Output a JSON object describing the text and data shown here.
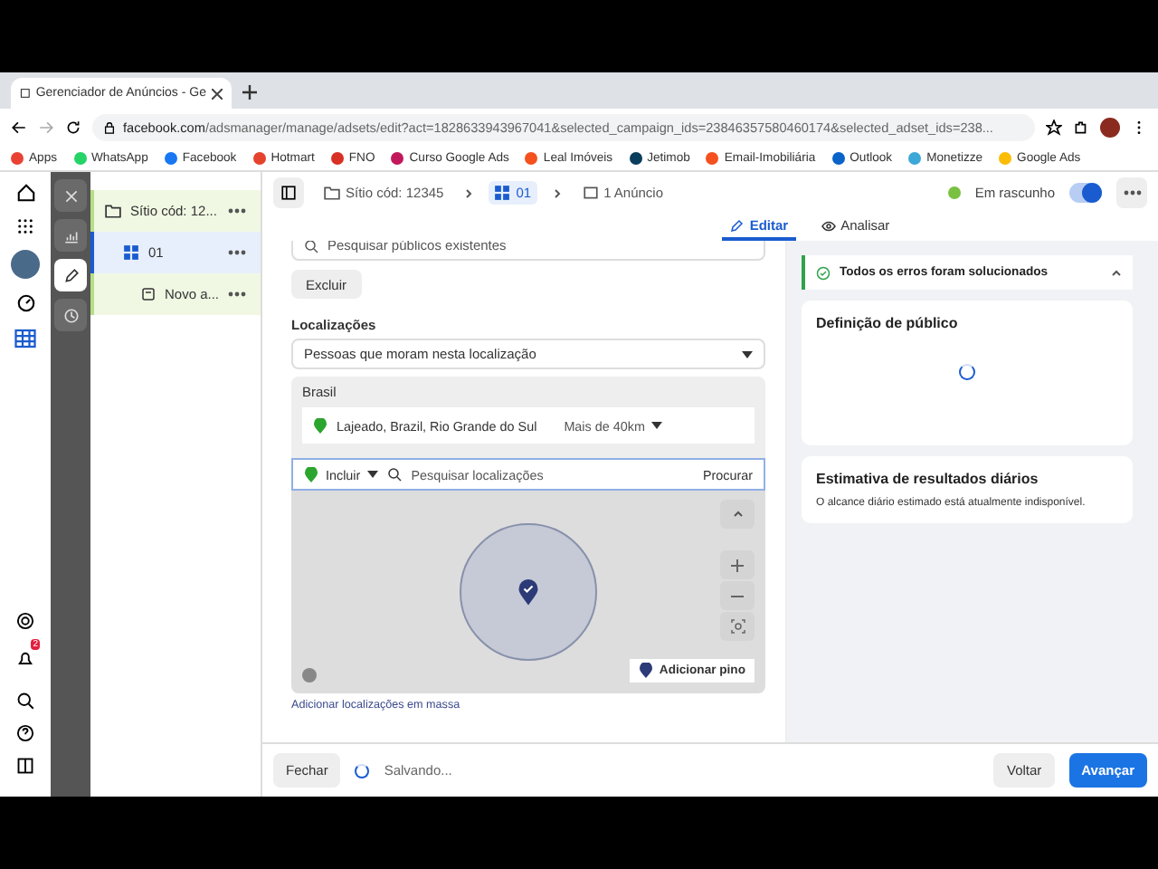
{
  "browser": {
    "tab_title": "Gerenciador de Anúncios - Ge",
    "url_host": "facebook.com",
    "url_path": "/adsmanager/manage/adsets/edit?act=1828633943967041&selected_campaign_ids=23846357580460174&selected_adset_ids=238...",
    "bookmarks": [
      {
        "label": "Apps",
        "color": "#e94235"
      },
      {
        "label": "WhatsApp",
        "color": "#25d366"
      },
      {
        "label": "Facebook",
        "color": "#1877f2"
      },
      {
        "label": "Hotmart",
        "color": "#e4432d"
      },
      {
        "label": "FNO",
        "color": "#d93025"
      },
      {
        "label": "Curso Google Ads",
        "color": "#c2185b"
      },
      {
        "label": "Leal Imóveis",
        "color": "#f4511e"
      },
      {
        "label": "Jetimob",
        "color": "#0b3d5c"
      },
      {
        "label": "Email-Imobiliária",
        "color": "#f4511e"
      },
      {
        "label": "Outlook",
        "color": "#0a64c8"
      },
      {
        "label": "Monetizze",
        "color": "#3ba8d8"
      },
      {
        "label": "Google Ads",
        "color": "#fbbc04"
      }
    ]
  },
  "nav": {
    "notification_count": "2"
  },
  "rail": [
    {
      "kind": "close",
      "selected": false
    },
    {
      "kind": "chart",
      "selected": false
    },
    {
      "kind": "edit",
      "selected": true
    },
    {
      "kind": "clock",
      "selected": false
    }
  ],
  "tree": [
    {
      "label": "Sítio cód: 12...",
      "selected": false,
      "children": [
        {
          "label": "01",
          "selected": true,
          "children": [
            {
              "label": "Novo a...",
              "selected": false
            }
          ]
        }
      ]
    }
  ],
  "header": {
    "breadcrumb": [
      {
        "kind": "campaign",
        "label": "Sítio cód: 12345",
        "selected": false
      },
      {
        "kind": "adset",
        "label": "01",
        "selected": true
      },
      {
        "kind": "ad",
        "label": "1 Anúncio",
        "selected": false
      }
    ],
    "status": "Em rascunho",
    "toggle_on": true
  },
  "tabs": [
    {
      "kind": "edit",
      "label": "Editar",
      "selected": true
    },
    {
      "kind": "view",
      "label": "Analisar",
      "selected": false
    }
  ],
  "form": {
    "audience_search_placeholder": "Pesquisar públicos existentes",
    "exclude_button": "Excluir",
    "locations_label": "Localizações",
    "locations_select": "Pessoas que moram nesta localização",
    "country": "Brasil",
    "location": "Lajeado, Brazil, Rio Grande do Sul",
    "radius": "Mais de 40km",
    "include": "Incluir",
    "location_search_placeholder": "Pesquisar localizações",
    "search_button": "Procurar",
    "add_pin": "Adicionar pino",
    "bulk_link": "Adicionar localizações em massa"
  },
  "summary": {
    "status": "Todos os erros foram solucionados",
    "audience_title": "Definição de público",
    "estimate_title": "Estimativa de resultados diários",
    "estimate_text": "O alcance diário estimado está atualmente indisponível."
  },
  "footer": {
    "close": "Fechar",
    "saving": "Salvando...",
    "back": "Voltar",
    "next": "Avançar"
  }
}
